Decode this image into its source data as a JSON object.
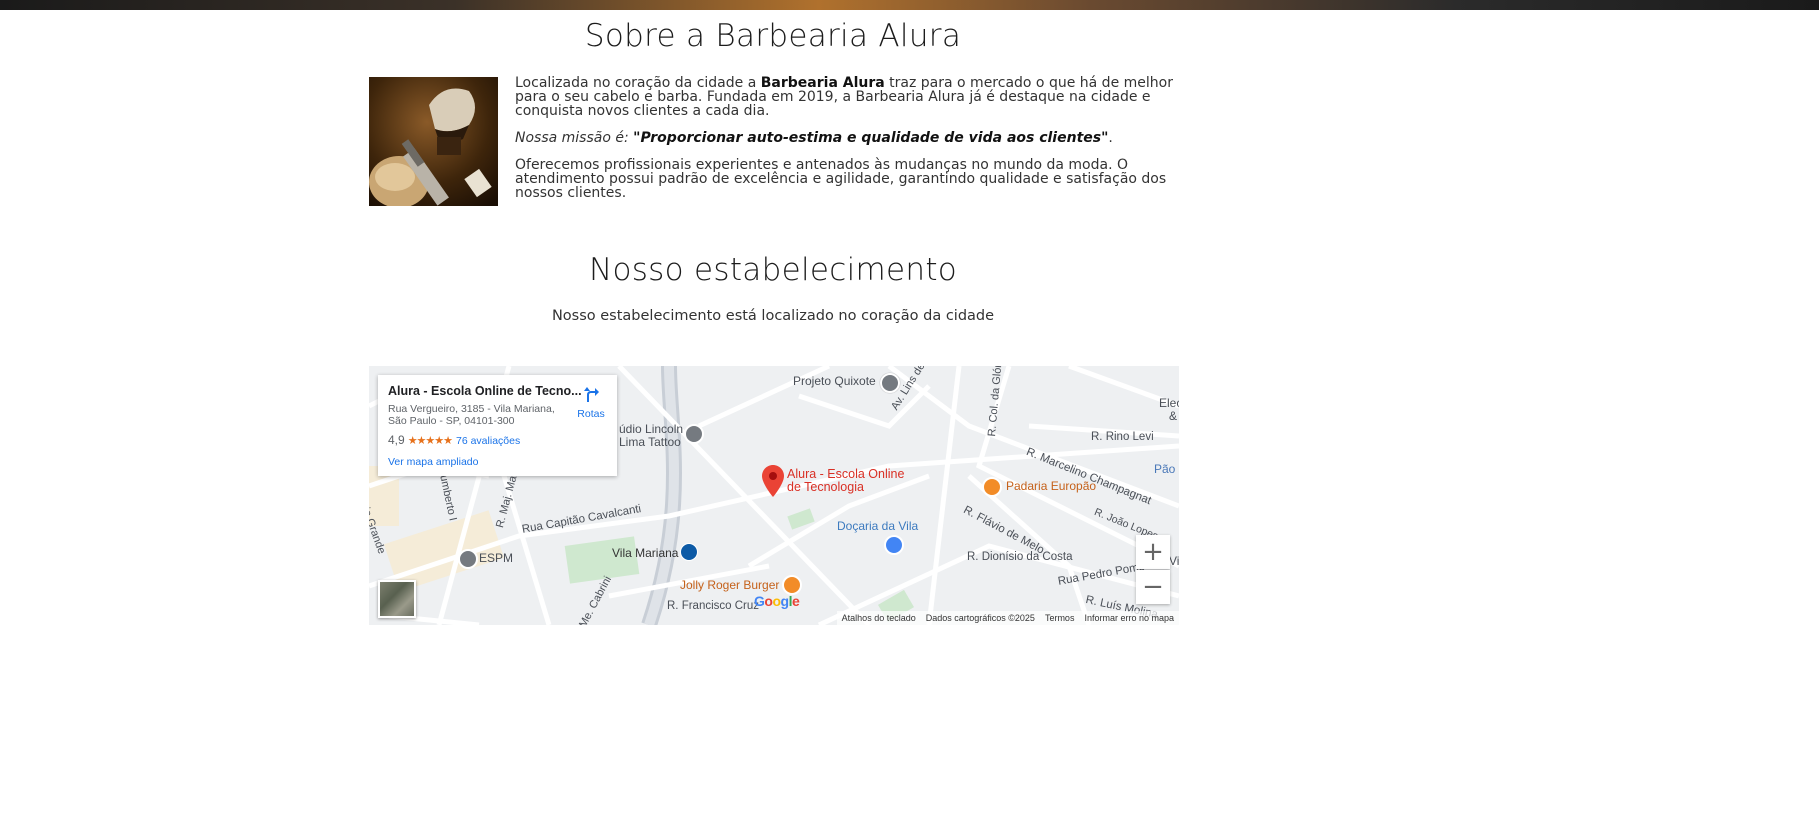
{
  "about": {
    "title": "Sobre a Barbearia Alura",
    "p1_pre": "Localizada no coração da cidade a ",
    "p1_strong": "Barbearia Alura",
    "p1_post": " traz para o mercado o que há de melhor para o seu cabelo e barba. Fundada em 2019, a Barbearia Alura já é destaque na cidade e conquista novos clientes a cada dia.",
    "mission_prefix": "Nossa missão é: ",
    "mission_quote": "\"Proporcionar auto-estima e qualidade de vida aos clientes\"",
    "mission_suffix": ".",
    "p3": "Oferecemos profissionais experientes e antenados às mudanças no mundo da moda. O atendimento possui padrão de excelência e agilidade, garantindo qualidade e satisfação dos nossos clientes."
  },
  "establishment": {
    "title": "Nosso estabelecimento",
    "subtitle": "Nosso estabelecimento está localizado no coração da cidade"
  },
  "map": {
    "card": {
      "name": "Alura - Escola Online de Tecno...",
      "address_line1": "Rua Vergueiro, 3185 - Vila Mariana,",
      "address_line2": "São Paulo - SP, 04101-300",
      "rating": "4,9",
      "stars": "★★★★★",
      "reviews": "76 avaliações",
      "more_link": "Ver mapa ampliado",
      "directions_label": "Rotas"
    },
    "pin_label_line1": "Alura - Escola Online",
    "pin_label_line2": "de Tecnologia",
    "labels": {
      "projeto_quixote": "Projeto Quixote",
      "studio_lincoln_1": "údio Lincoln",
      "studio_lincoln_2": "Lima Tattoo",
      "av_lins": "Av. Lins de Vasconcel",
      "r_col": "R. Col. da Glór",
      "electro_1": "Electr",
      "electro_2": "& C",
      "r_rino": "R. Rino Levi",
      "r_marcelino": "R. Marcelino Champagnat",
      "pao": "Pão",
      "padaria": "Padaria Europão",
      "r_joao": "R. João Lopes",
      "r_flavio": "R. Flávio de Melo",
      "docaria": "Doçaria da Vila",
      "r_dionisio": "R. Dionísio da Costa",
      "rua_pedro": "Rua Pedro Pomp",
      "r_luis": "R. Luís Molina",
      "vila_mariana": "Vila Mariana",
      "jolly": "Jolly Roger Burger",
      "r_francisco": "R. Francisco Cruz",
      "rua_capitao": "Rua Capitão Cavalcanti",
      "r_maj": "R. Maj. Marag",
      "umberto": "umberto I",
      "espm": "ESPM",
      "io_grande": "io Grande",
      "me_cabrini": "Me. Cabrini",
      "vi": "Vi"
    },
    "google": "Google",
    "attribution": {
      "shortcuts": "Atalhos do teclado",
      "data": "Dados cartográficos ©2025",
      "terms": "Termos",
      "report": "Informar erro no mapa"
    },
    "zoom_in": "+",
    "zoom_out": "−"
  },
  "colors": {
    "pin": "#ea4335",
    "poi_food": "#f28c28",
    "poi_gray": "#757a80",
    "park": "#c8e6c9",
    "link": "#1a73e8"
  }
}
